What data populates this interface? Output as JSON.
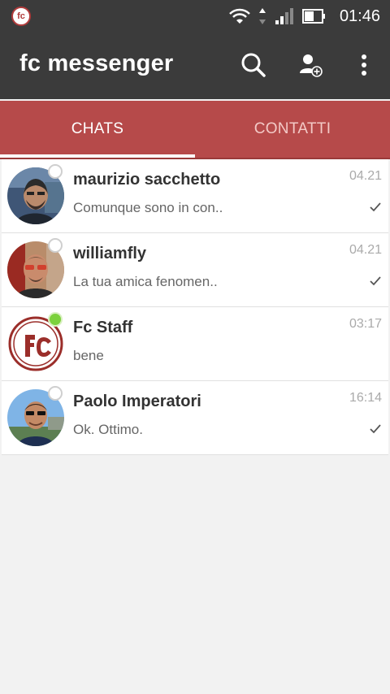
{
  "status_bar": {
    "app_icon_text": "fc",
    "time": "01:46"
  },
  "app_bar": {
    "title": "fc messenger"
  },
  "tabs": [
    {
      "label": "CHATS",
      "active": true
    },
    {
      "label": "CONTATTI",
      "active": false
    }
  ],
  "chats": [
    {
      "name": "maurizio sacchetto",
      "preview": "Comunque sono in con..",
      "time": "04.21",
      "online": false,
      "read_check": true
    },
    {
      "name": "williamfly",
      "preview": "La tua amica fenomen..",
      "time": "04.21",
      "online": false,
      "read_check": true
    },
    {
      "name": "Fc Staff",
      "preview": "bene",
      "time": "03:17",
      "online": true,
      "read_check": false
    },
    {
      "name": "Paolo Imperatori",
      "preview": "Ok. Ottimo.",
      "time": "16:14",
      "online": false,
      "read_check": true
    }
  ],
  "colors": {
    "toolbar": "#3b3b3b",
    "accent": "#b64a4a",
    "online": "#7bd13c"
  }
}
